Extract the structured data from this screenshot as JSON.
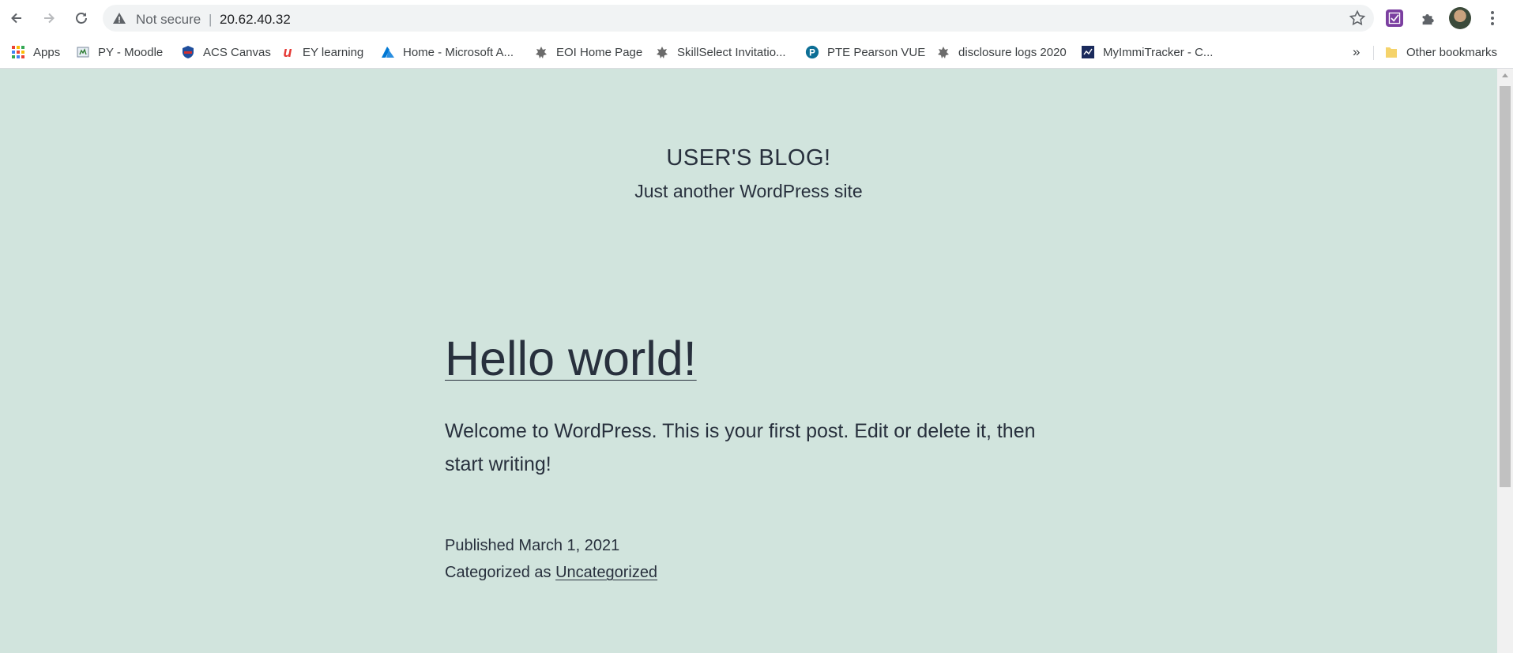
{
  "browser": {
    "security_label": "Not secure",
    "separator": "|",
    "url": "20.62.40.32",
    "more_bookmarks": "»",
    "other_bookmarks": "Other bookmarks"
  },
  "bookmarks": [
    {
      "label": "Apps",
      "icon": "apps-grid-icon"
    },
    {
      "label": "PY - Moodle",
      "icon": "moodle-icon"
    },
    {
      "label": "ACS Canvas",
      "icon": "acs-shield-icon"
    },
    {
      "label": "EY learning",
      "icon": "ey-u-icon"
    },
    {
      "label": "Home - Microsoft A...",
      "icon": "azure-icon"
    },
    {
      "label": "EOI Home Page",
      "icon": "gov-crest-icon"
    },
    {
      "label": "SkillSelect Invitatio...",
      "icon": "gov-crest-icon"
    },
    {
      "label": "PTE Pearson VUE",
      "icon": "pearson-p-icon"
    },
    {
      "label": "disclosure logs 2020",
      "icon": "gov-crest-icon"
    },
    {
      "label": "MyImmiTracker - C...",
      "icon": "immitracker-icon"
    }
  ],
  "site": {
    "title": "USER'S BLOG!",
    "tagline": "Just another WordPress site"
  },
  "post": {
    "title": "Hello world!",
    "body": "Welcome to WordPress. This is your first post. Edit or delete it, then start writing!",
    "published_prefix": "Published",
    "published_date": "March 1, 2021",
    "category_prefix": "Categorized as",
    "category": "Uncategorized"
  },
  "colors": {
    "page_background": "#d1e4dd",
    "text": "#28303d"
  }
}
